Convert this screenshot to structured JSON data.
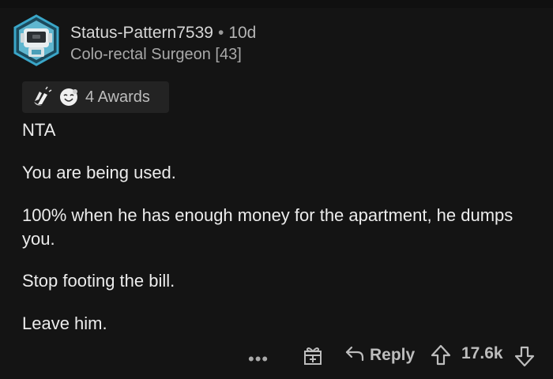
{
  "comment": {
    "author": "Status-Pattern7539",
    "separator": "•",
    "age": "10d",
    "flair": "Colo-rectal Surgeon [43]",
    "awards_label": "4 Awards",
    "paragraphs": [
      "NTA",
      "You are being used.",
      "100% when he has enough money for the apartment, he dumps you.",
      "Stop footing the bill.",
      "Leave him."
    ]
  },
  "actions": {
    "more": "•••",
    "reply_label": "Reply",
    "score": "17.6k"
  },
  "icons": {
    "avatar": "robot-avatar-icon",
    "award1": "clapping-hands-award-icon",
    "award2": "wholesome-award-icon",
    "gift": "gift-icon",
    "reply": "reply-arrow-icon",
    "upvote": "upvote-arrow-icon",
    "downvote": "downvote-arrow-icon"
  },
  "colors": {
    "background": "#141414",
    "avatar_ring": "#3aa6c8"
  }
}
